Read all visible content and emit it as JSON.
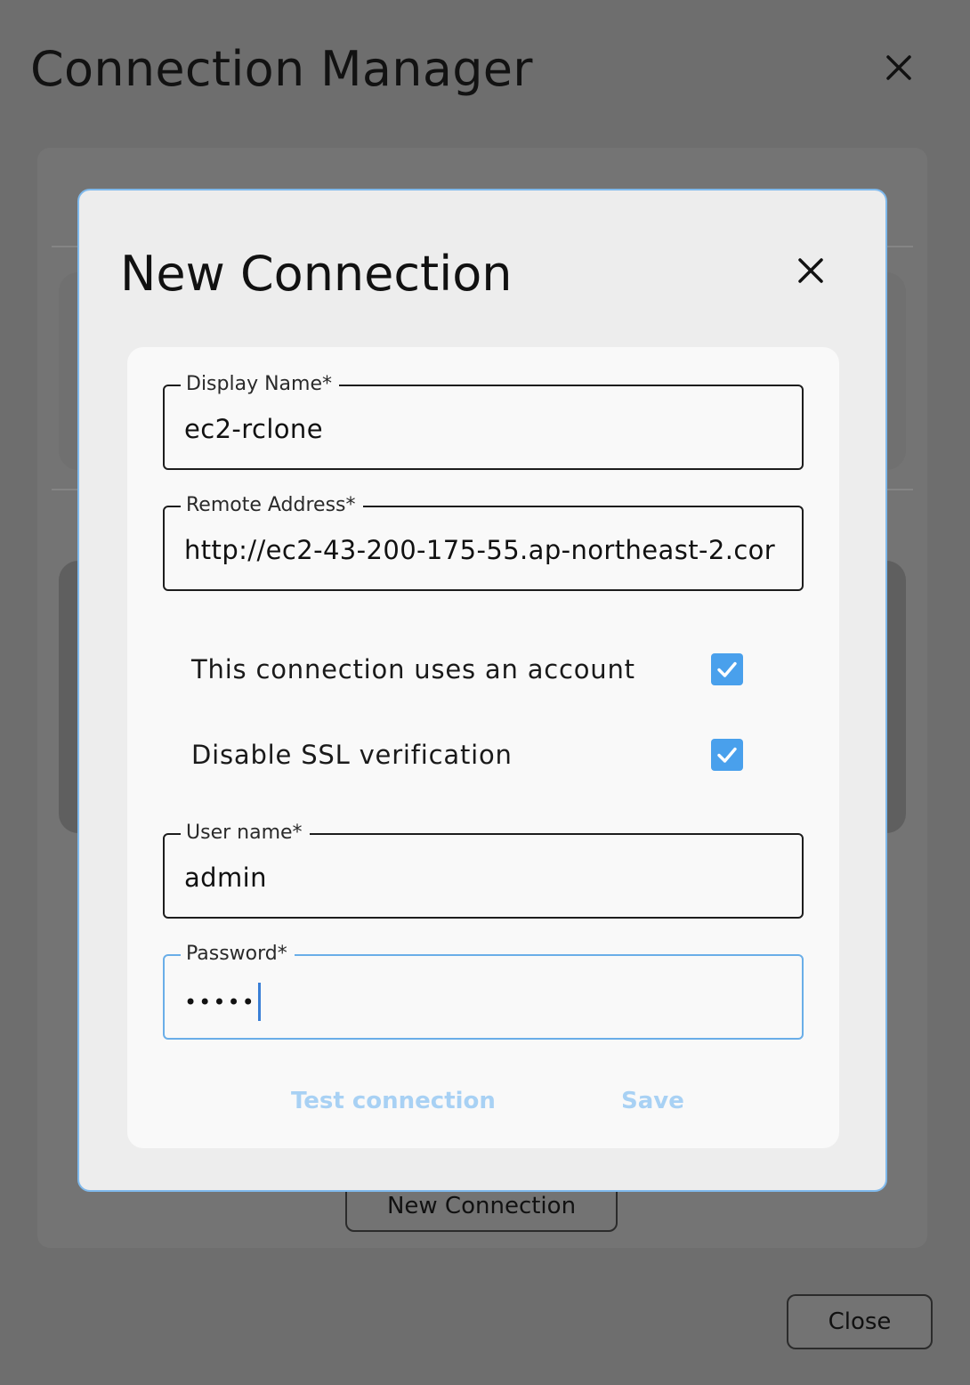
{
  "manager": {
    "title": "Connection Manager",
    "new_connection_label": "New Connection",
    "close_label": "Close"
  },
  "dialog": {
    "title": "New Connection",
    "fields": {
      "display_name": {
        "label": "Display Name*",
        "value": "ec2-rclone"
      },
      "remote_address": {
        "label": "Remote Address*",
        "value": "http://ec2-43-200-175-55.ap-northeast-2.cor"
      },
      "user_name": {
        "label": "User name*",
        "value": "admin"
      },
      "password": {
        "label": "Password*",
        "value": "•••••"
      }
    },
    "checkboxes": {
      "uses_account": {
        "label": "This connection uses an account",
        "checked": true
      },
      "disable_ssl": {
        "label": "Disable SSL verification",
        "checked": true
      }
    },
    "buttons": {
      "test_label": "Test connection",
      "save_label": "Save"
    }
  },
  "colors": {
    "accent": "#49a0ec",
    "dialog_border": "#7fb9ec",
    "disabled_button_text": "#a8d1f4",
    "overlay": "#6e6e6e"
  },
  "icons": {
    "close": "close-icon",
    "check": "checkmark-icon"
  }
}
